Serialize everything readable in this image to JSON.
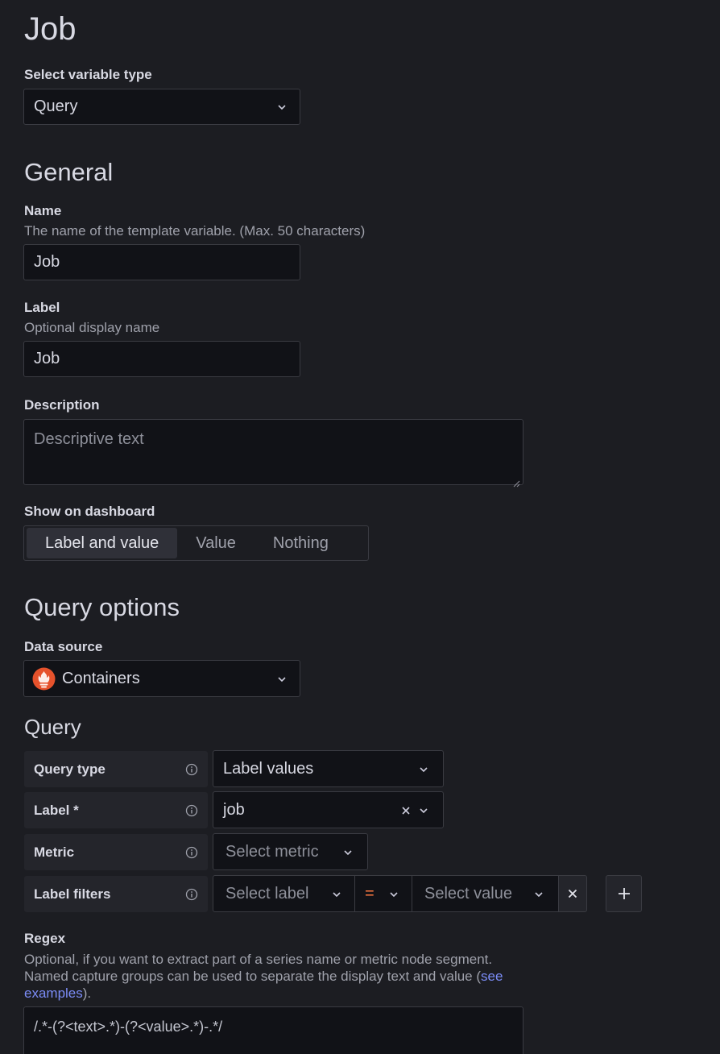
{
  "page": {
    "title": "Job"
  },
  "variable_type": {
    "label": "Select variable type",
    "value": "Query"
  },
  "general": {
    "heading": "General",
    "name": {
      "label": "Name",
      "description": "The name of the template variable. (Max. 50 characters)",
      "value": "Job"
    },
    "label": {
      "label": "Label",
      "description": "Optional display name",
      "value": "Job"
    },
    "description": {
      "label": "Description",
      "placeholder": "Descriptive text",
      "value": ""
    },
    "show_on_dashboard": {
      "label": "Show on dashboard",
      "options": [
        "Label and value",
        "Value",
        "Nothing"
      ],
      "selected": "Label and value"
    }
  },
  "query_options": {
    "heading": "Query options",
    "data_source": {
      "label": "Data source",
      "value": "Containers",
      "icon": "prometheus-icon",
      "icon_color": "#e6522c"
    }
  },
  "query": {
    "heading": "Query",
    "rows": [
      {
        "label": "Query type",
        "value": "Label values"
      },
      {
        "label": "Label *",
        "value": "job"
      },
      {
        "label": "Metric",
        "placeholder": "Select metric"
      },
      {
        "label": "Label filters",
        "label_placeholder": "Select label",
        "operator": "=",
        "value_placeholder": "Select value"
      }
    ]
  },
  "regex": {
    "label": "Regex",
    "description_line1": "Optional, if you want to extract part of a series name or metric node segment.",
    "description_line2": "Named capture groups can be used to separate the display text and value (",
    "link_part1": "see",
    "link_part2": "examples",
    "description_end": ").",
    "value": "/.*-(?<text>.*)-(?<value>.*)-.*/"
  },
  "colors": {
    "accent_link": "#7b8cf6",
    "operator": "#ff7941",
    "background": "#1c1d22"
  }
}
